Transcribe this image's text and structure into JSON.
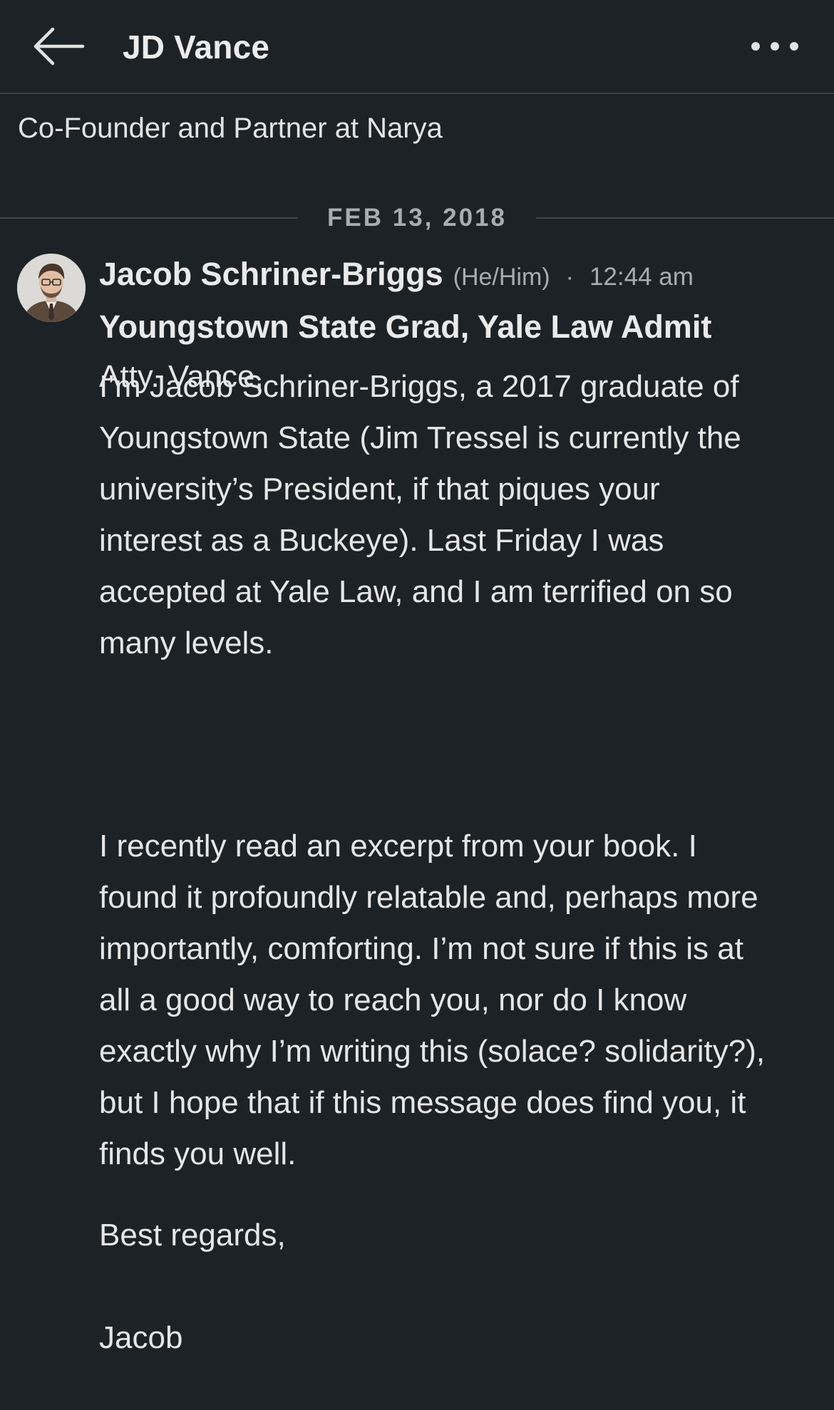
{
  "header": {
    "back_icon": "arrow-left-icon",
    "title": "JD Vance",
    "more_icon": "more-horizontal-icon"
  },
  "subtitle": "Co-Founder and Partner at Narya",
  "date_divider": "FEB 13, 2018",
  "message": {
    "sender_name": "Jacob Schriner-Briggs",
    "pronouns": "(He/Him)",
    "separator": "·",
    "time": "12:44 am",
    "headline": "Youngstown State Grad, Yale Law Admit",
    "greeting": "Atty. Vance,",
    "paragraph_1": "I’m Jacob Schriner-Briggs, a 2017 graduate of Youngstown State (Jim Tressel is currently the university’s President, if that piques your interest as a Buckeye). Last Friday I was accepted at Yale Law, and I am terrified on so many levels.",
    "paragraph_2": "I recently read an excerpt from your book. I found it profoundly relatable and, perhaps more importantly, comforting. I’m not sure if this is at all a good way to reach you, nor do I know exactly why I’m writing this (solace? solidarity?), but I hope that if this message does find you, it finds you well.",
    "closing": "Best regards,",
    "signature": "Jacob"
  },
  "colors": {
    "background": "#1d2226",
    "text": "#e6e6e6",
    "muted": "#a9adb1",
    "divider": "#3f454b"
  }
}
